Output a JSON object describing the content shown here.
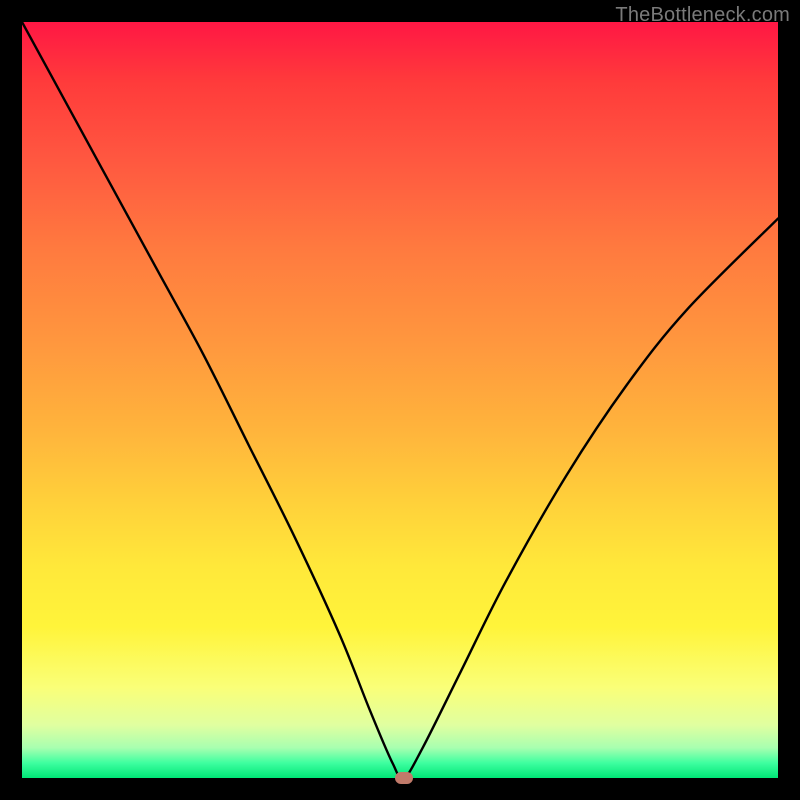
{
  "watermark": "TheBottleneck.com",
  "chart_data": {
    "type": "line",
    "title": "",
    "xlabel": "",
    "ylabel": "",
    "xlim": [
      0,
      100
    ],
    "ylim": [
      0,
      100
    ],
    "grid": false,
    "legend": false,
    "series": [
      {
        "name": "curve",
        "x": [
          0,
          6,
          12,
          18,
          24,
          30,
          36,
          42,
          46,
          49,
          50.5,
          53,
          58,
          64,
          72,
          80,
          88,
          100
        ],
        "values": [
          100,
          89,
          78,
          67,
          56,
          44,
          32,
          19,
          9,
          2,
          0,
          4,
          14,
          26,
          40,
          52,
          62,
          74
        ]
      }
    ],
    "marker": {
      "x": 50.5,
      "y": 0,
      "color": "#c17a6a"
    },
    "gradient_stops": [
      {
        "offset": 0,
        "color": "#ff1744"
      },
      {
        "offset": 50,
        "color": "#ffb43c"
      },
      {
        "offset": 80,
        "color": "#fff43a"
      },
      {
        "offset": 100,
        "color": "#00e676"
      }
    ]
  }
}
